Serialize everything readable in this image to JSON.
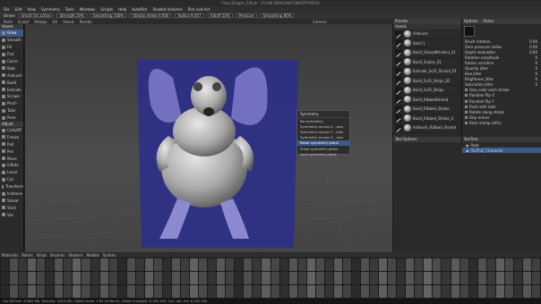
{
  "window": {
    "title": "Flow_Dragon_5W.ph - [FLOW DRAGON/CONCEPT/REFS]"
  },
  "menu": [
    "File",
    "Edit",
    "View",
    "Symmetry",
    "Tools",
    "Windows",
    "Scripts",
    "Help",
    "AutoPick",
    "Shaded Volumes",
    "Pick and Act"
  ],
  "toolbar": {
    "items": [
      "Stroke",
      "Smart list active",
      "Strength 20%",
      "Smoothing 100%",
      "Steady stroke 0.000",
      "Radius 9.057",
      "Falloff 50%",
      "Pressure",
      "Smoothing 80%"
    ]
  },
  "modes": [
    "Paint",
    "Sculpt",
    "Retopo",
    "UV",
    "Voxels",
    "Render"
  ],
  "viewport": {
    "label": "Camera"
  },
  "left_tools": {
    "header": "Voxels",
    "items": [
      "Grow",
      "Smooth",
      "Fill",
      "Flat",
      "Carve",
      "Blob",
      "Airbrush",
      "Build",
      "Extrude",
      "Scrape",
      "Pinch",
      "Tube",
      "Pose",
      "Cut&Off",
      "Freeze",
      "Pull",
      "Pen",
      "Move",
      "Inflate",
      "Lasso",
      "Cut",
      "Transform",
      "Instance",
      "Smear",
      "Shell",
      "Vox"
    ],
    "active_index": 0,
    "adjust_header": "Adjust"
  },
  "presets": {
    "title": "Presets",
    "tab2": "Voxels",
    "items": [
      "Airbrush",
      "Solid 1",
      "Build_SharpWrinkles_01",
      "Build_Scales_01",
      "Extrude_SciFi_Strand_01",
      "Build_SciFi_Strips_02",
      "Build_SciFi_Strips",
      "Build_RibbedStrand",
      "Build_Ribbed_Stroke",
      "Build_Ribbed_Stroke_2",
      "Airbrush_Ribbed_Strand"
    ]
  },
  "options": {
    "title": "Options",
    "tab2": "Picker",
    "rows": [
      "Brush rotation",
      "Zero pressure radius",
      "Depth modulator",
      "Rotation amplitude",
      "Radius variation",
      "Opacity jitter",
      "Hue jitter",
      "Brightness jitter",
      "Saturation jitter",
      "Vary color each stroke",
      "Random flip X",
      "Random flip Y",
      "Paint with dots",
      "Rotate along stroke",
      "Skip eraser",
      "Start stamp (d/m)"
    ],
    "values": [
      "0.00",
      "0.00",
      "0.00",
      "0",
      "0",
      "0",
      "0",
      "0",
      "0",
      "",
      "",
      "",
      "",
      "",
      "",
      ""
    ]
  },
  "tool_options_tab": "Tool Options",
  "outliner": {
    "title": "VoxTree",
    "root": "Root",
    "node": "[Sc]Full_Character"
  },
  "popup": {
    "title": "Symmetry",
    "items": [
      "No symmetry",
      "Symmetry across X - axis",
      "Symmetry across Y - axis",
      "Symmetry across Z - axis",
      "Reset symmetry plane",
      "Show symmetry plane",
      "Lock symmetry plane"
    ],
    "highlight": 4
  },
  "bottom_tabs": [
    "Materials",
    "Masks",
    "Strips",
    "Brushes",
    "Shaders",
    "Models",
    "Splines"
  ],
  "status": "Fps:38   Free: 22645 Mb, Textures: 256.0 Mb, Object scale: 1.63 (Uniform), Visible triangles: 8 262 265, Curr. obj. tris: 8 262 265",
  "colors": {
    "accent": "#3c5a86",
    "board": "#2c2f8a"
  }
}
